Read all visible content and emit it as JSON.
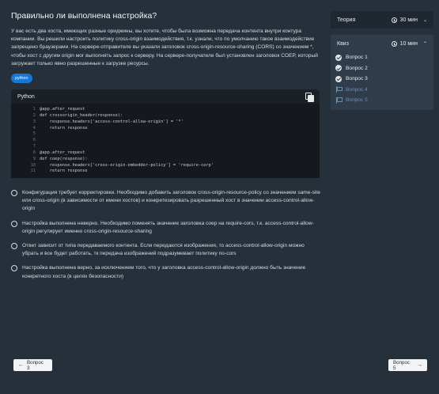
{
  "question": {
    "title": "Правильно ли выполнена настройка?",
    "text": "У вас есть два хоста, имеющих разные ориджины, вы хотите, чтобы была возможна передача контента внутри контура компании. Вы решили настроить политику cross-origin взаимодействия, т.к. узнали, что по умолчанию такое взаимодействие запрещено браузерами. На сервере-отправителе вы указали заголовок cross-origin-resource-sharing (CORS) со значением *, чтобы хост с другим origin мог выполнять запрос к серверу. На сервере-получателе был установлен заголовок COEP, который загружает только явно разрешенные к загрузке ресурсы.",
    "tag": "python"
  },
  "code": {
    "language_label": "Python",
    "lines": [
      {
        "n": "1",
        "text": "@app.after_request"
      },
      {
        "n": "2",
        "text": "def crossorigin_header(response):"
      },
      {
        "n": "3",
        "text": "    response.headers['access-control-allow-origin'] = '*'"
      },
      {
        "n": "4",
        "text": "    return response"
      },
      {
        "n": "5",
        "text": ""
      },
      {
        "n": "6",
        "text": ""
      },
      {
        "n": "7",
        "text": ""
      },
      {
        "n": "8",
        "text": "@app.after_request"
      },
      {
        "n": "9",
        "text": "def coep(response):"
      },
      {
        "n": "10",
        "text": "    response.headers['cross-origin-embedder-policy'] = 'require-corp'"
      },
      {
        "n": "11",
        "text": "    return response"
      }
    ]
  },
  "options": [
    "Конфигурация требует корректировки. Необходимо добавить заголовок cross-origin-resource-policy со значением same-site или cross-origin (в зависимости от имени хостов) и конкретизировать разрешенный хост в значении access-control-allow-origin",
    "Настройка выполнена неверно. Необходимо поменять значение заголовка coep на require-cors, т.к. access-control-allow-origin регулирует именно cross-origin-resource-sharing",
    "Ответ зависит от типа передаваемого контента. Если передаются изображения, то access-control-allow-origin можно убрать и все будет работать, тк передача изображений подразумевает политику no-cors",
    "Настройка выполнена верно, за исключением того, что у заголовка access-control-allow-origin должно быть значение конкретного хоста (в целях безопасности)"
  ],
  "sidebar": {
    "theory_label": "Теория",
    "theory_time": "30 мин",
    "quiz_label": "Квиз",
    "quiz_time": "10 мин",
    "items": [
      {
        "label": "Вопрос 1",
        "status": "done"
      },
      {
        "label": "Вопрос 2",
        "status": "done"
      },
      {
        "label": "Вопрос 3",
        "status": "done"
      },
      {
        "label": "Вопрос 4",
        "status": "pending"
      },
      {
        "label": "Вопрос 5",
        "status": "pending"
      }
    ]
  },
  "nav": {
    "prev_label": "Вопрос 3",
    "next_label": "Вопрос 5"
  }
}
